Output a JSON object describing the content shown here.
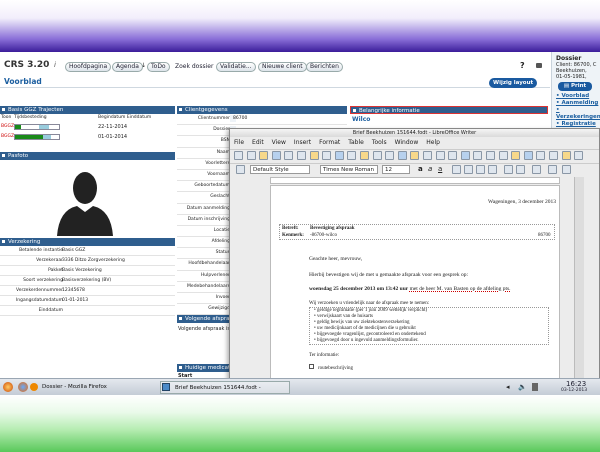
{
  "crs": {
    "title": "CRS 3.20",
    "info_icon": "i",
    "nav": [
      "Hoofdpagina",
      "Agenda",
      "ToDo",
      "Zoek dossier",
      "Validatie...",
      "Nieuwe client",
      "Berichten"
    ],
    "help": "?",
    "voorblad": "Voorblad",
    "wijzig": "Wijzig layout"
  },
  "trajecten": {
    "title": "Basis GGZ Trajecten",
    "col1": "Toon",
    "col2": "Tijdsbesteding",
    "col3": "Begindatum Einddatum",
    "rows": [
      {
        "k": "BGGZ",
        "date": "22-11-2014"
      },
      {
        "k": "BGGZ",
        "date": "01-01-2014"
      }
    ]
  },
  "pasfoto": {
    "title": "Pasfoto"
  },
  "verzekering": {
    "title": "Verzekering",
    "rows": [
      {
        "k": "Betalende instantie",
        "v": "Basis GGZ"
      },
      {
        "k": "Verzekeraar",
        "v": "3336    Ditzo Zorgverzekering"
      },
      {
        "k": "Pakket",
        "v": "Basis Verzekering"
      },
      {
        "k": "Soort verzekering",
        "v": "Basisverzekering (BV)"
      },
      {
        "k": "Verzekerdennummer",
        "v": "12345678"
      },
      {
        "k": "Ingangsdatumdatum",
        "v": "01-01-2013"
      },
      {
        "k": "Einddatum",
        "v": ""
      }
    ]
  },
  "client": {
    "title": "Clientgegevens",
    "labels": [
      "Clientnummer",
      "Dossier",
      "BSN",
      "Naam",
      "Voorletters",
      "Voornaam",
      "Geboortedatum",
      "Geslacht",
      "Datum aanmelding",
      "Datum inschrijving",
      "Locatie",
      "Afdeling",
      "Status",
      "Hoofdbehandelaar",
      "Hulpverlener",
      "Medebehandelaars",
      "Invoer",
      "Gewijzigd"
    ],
    "first": "86700"
  },
  "volgende": {
    "title": "Volgende afspraken",
    "text": "Volgende afspraak is op"
  },
  "huidige": {
    "title": "Huidige medicatie",
    "start": "Start"
  },
  "belangrijk": {
    "title": "Belangrijke informatie",
    "text": "Wilco"
  },
  "dossier": {
    "title": "Dossier",
    "line1": "Client: 86700, C",
    "line2": "Beekhuizen,",
    "line3": "01-05-1981,",
    "print": "Print",
    "links": [
      "Voorblad",
      "Aanmelding",
      "Verzekeringen",
      "Registratie"
    ]
  },
  "writer": {
    "title": "Brief Beekhuizen 151644.fodt - LibreOffice Writer",
    "menu": [
      "File",
      "Edit",
      "View",
      "Insert",
      "Format",
      "Table",
      "Tools",
      "Window",
      "Help"
    ],
    "style": "Default Style",
    "font": "Times New Roman",
    "size": "12",
    "doc": {
      "date": "Wageningen, 3 december 2013",
      "betreft_label": "Betreft:",
      "betreft": "Bevestiging afspraak",
      "kenmerk_label": "Kenmerk:",
      "kenmerk": "-86700-wilco",
      "kenmerk_num": "86700",
      "greeting": "Geachte heer, mevrouw,",
      "intro": "Hierbij bevestigen wij de met u gemaakte afspraak voor een gesprek op:",
      "appt_pre": "woensdag 25 december 2013 om 13:42 uur",
      "appt_post": "met de heer M. van Basten op de afdeling pts.",
      "bring": "Wij verzoeken u vriendelijk naar de afspraak mee te nemen:",
      "items": [
        "geldige legitimatie (per 1 juni 2009 wettelijk verplicht)",
        "verwijskaart van de huisarts",
        "geldig bewijs van uw ziektekostenverzekering",
        "uw medicijnkaart of de medicijnen die u gebruikt",
        "bijgevoegde vragenlijst, gecontroleerd en ondertekend",
        "bijgevoegd door u ingevuld aanmeldingsformulier."
      ],
      "info": "Ter informatie:",
      "check": "routebeschrijving"
    }
  },
  "taskbar": {
    "items": [
      "Dossier - Mozilla Firefox",
      "Brief Beekhuizen 151644.fodt - LibreOffice Writer"
    ],
    "time": "16:23",
    "date": "03-12-2013"
  }
}
